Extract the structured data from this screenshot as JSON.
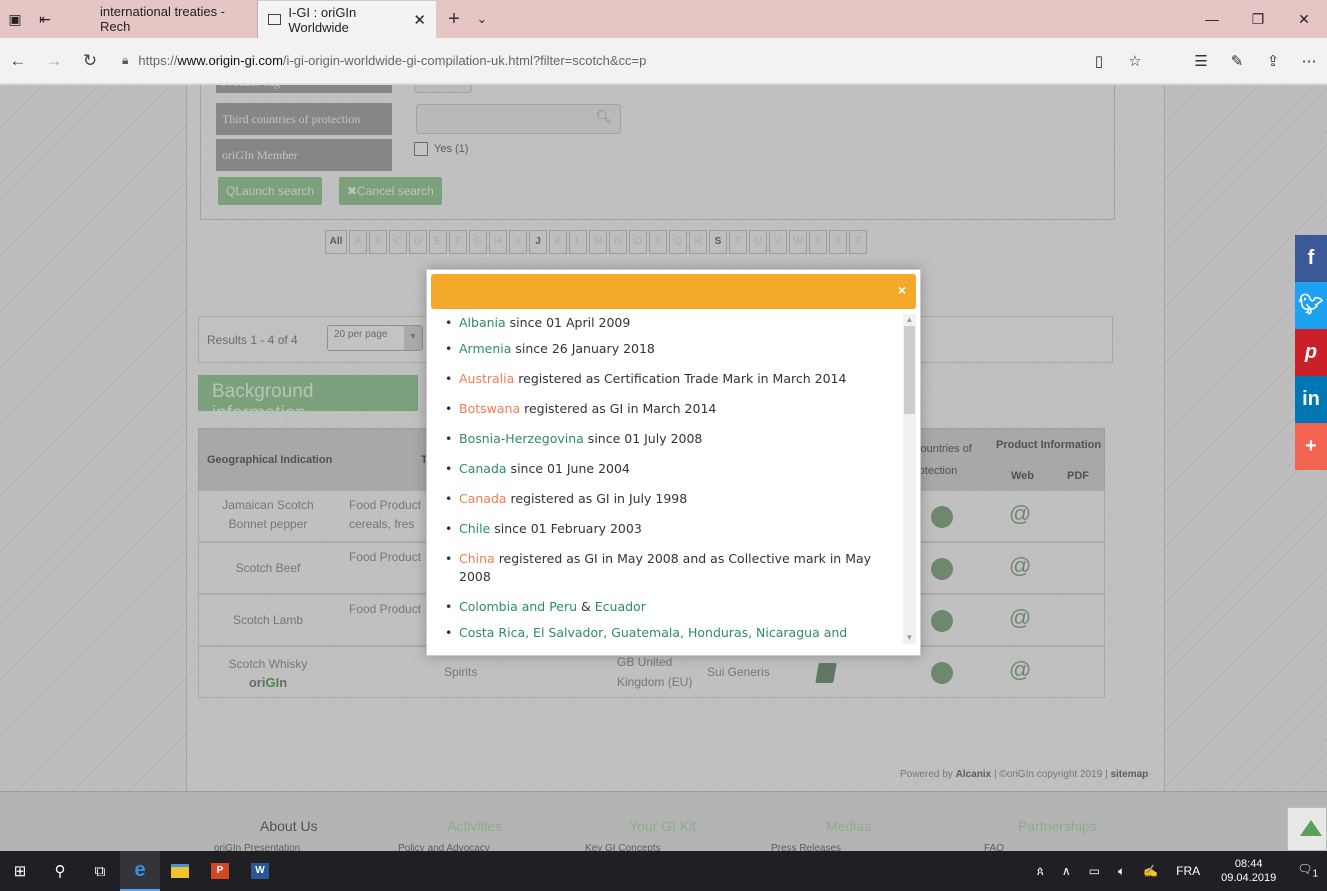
{
  "browser": {
    "tabs": [
      {
        "label": "international treaties - Rech",
        "active": false
      },
      {
        "label": "I-GI : oriGIn Worldwide",
        "active": true
      }
    ],
    "url_scheme": "https://",
    "url_host": "www.origin-gi.com",
    "url_path": "/i-gi-origin-worldwide-gi-compilation-uk.html?filter=scotch&cc=p"
  },
  "search_form": {
    "label_product_tag": "Product Tag",
    "label_third_countries": "Third countries of protection",
    "label_origin_member": "oriGIn Member",
    "member_option": "Yes (1)",
    "launch_button": "QLaunch search",
    "cancel_button": "✖Cancel search",
    "alphabet": [
      "All",
      "A",
      "B",
      "C",
      "D",
      "E",
      "F",
      "G",
      "H",
      "I",
      "J",
      "K",
      "L",
      "M",
      "N",
      "O",
      "P",
      "Q",
      "R",
      "S",
      "T",
      "U",
      "V",
      "W",
      "X",
      "Y",
      "Z"
    ],
    "active_letters": [
      "All",
      "J",
      "S"
    ]
  },
  "results": {
    "summary": "Results 1 - 4 of 4",
    "per_page": "20 per page"
  },
  "background_info_button": "Background information",
  "table": {
    "headers": {
      "gi": "Geographical Indication",
      "type_initial": "T",
      "third_countries": "countries of",
      "third_countries_2": "rotection",
      "product_info": "Product Information",
      "web": "Web",
      "pdf": "PDF"
    },
    "rows": [
      {
        "gi_line1": "Jamaican Scotch",
        "gi_line2": "Bonnet pepper",
        "type_line1": "Food Product",
        "type_line2": "cereals, fres"
      },
      {
        "gi_line1": "Scotch Beef",
        "gi_line2": "",
        "type_line1": "Food Product",
        "type_line2": ""
      },
      {
        "gi_line1": "Scotch Lamb",
        "gi_line2": "",
        "type_line1": "Food Product",
        "type_line2": ""
      },
      {
        "gi_line1": "Scotch Whisky",
        "gi_line2": "",
        "type_line1": "Spirits",
        "type_line2": "",
        "country_line1": "GB United",
        "country_line2": "Kingdom (EU)",
        "protection": "Sui Generis",
        "badge_part1": "ori",
        "badge_part2": "GI",
        "badge_part3": "n"
      }
    ]
  },
  "powered_by": {
    "prefix": "Powered by ",
    "brand": "Alcanix",
    "suffix": " | ©oriGIn copyright 2019 | ",
    "sitemap": "sitemap"
  },
  "footer": {
    "columns": [
      {
        "title": "About Us",
        "sub": "oriGIn Presentation"
      },
      {
        "title": "Activities",
        "sub": "Policy and Advocacy"
      },
      {
        "title": "Your GI Kit",
        "sub": "Key GI Concepts"
      },
      {
        "title": "Medias",
        "sub": "Press Releases"
      },
      {
        "title": "Partnerships",
        "sub": "FAQ"
      }
    ]
  },
  "social": {
    "facebook": "f",
    "twitter": "t",
    "pinterest": "p",
    "linkedin": "in",
    "more": "+",
    "colors": {
      "facebook": "#3b5998",
      "twitter": "#1da1f2",
      "pinterest": "#cb2027",
      "linkedin": "#0077b5",
      "more": "#f26450"
    }
  },
  "modal": {
    "close_label": "×",
    "items": [
      {
        "name": "Albania",
        "color": "green",
        "text": " since 01 April 2009"
      },
      {
        "name": "Armenia",
        "color": "green",
        "text": " since 26 January 2018"
      },
      {
        "name": "Australia",
        "color": "orange",
        "text": " registered as Certification Trade Mark in March 2014"
      },
      {
        "name": "Botswana",
        "color": "orange",
        "text": " registered as GI in March 2014"
      },
      {
        "name": "Bosnia-Herzegovina",
        "color": "green",
        "text": " since 01 July 2008"
      },
      {
        "name": "Canada",
        "color": "green",
        "text": " since 01 June 2004"
      },
      {
        "name": "Canada",
        "color": "orange",
        "text": " registered as GI in July 1998"
      },
      {
        "name": "Chile",
        "color": "green",
        "text": " since 01 February 2003"
      },
      {
        "name": "China",
        "color": "orange",
        "text": " registered as GI in May 2008 and as Collective mark in May 2008"
      },
      {
        "name": "Colombia and Peru",
        "color": "green",
        "text": " & ",
        "name2": "Ecuador"
      },
      {
        "name": "Costa Rica, El Salvador, Guatemala, Honduras, Nicaragua and Panama",
        "color": "green",
        "text": ""
      }
    ]
  },
  "taskbar": {
    "language": "FRA",
    "time": "08:44",
    "date": "09.04.2019",
    "notification_count": "1"
  }
}
